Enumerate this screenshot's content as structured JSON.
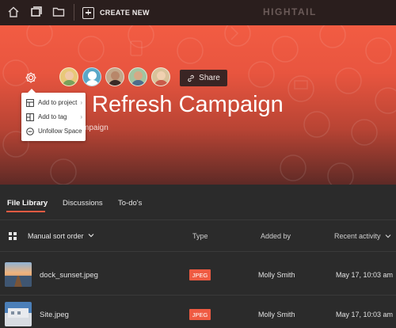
{
  "topbar": {
    "create_new_label": "CREATE NEW",
    "logo_text": "HIGHTAIL"
  },
  "hero": {
    "title": "Refresh Campaign",
    "subtitle": "mpaign",
    "share_label": "Share",
    "accent_color": "#ef5b42"
  },
  "dropdown": {
    "items": [
      {
        "label": "Add to project",
        "icon": "project-icon",
        "has_submenu": true
      },
      {
        "label": "Add to tag",
        "icon": "tag-icon",
        "has_submenu": true
      },
      {
        "label": "Unfollow Space",
        "icon": "unfollow-icon",
        "has_submenu": false
      }
    ]
  },
  "tabs": [
    {
      "label": "File Library",
      "active": true
    },
    {
      "label": "Discussions",
      "active": false
    },
    {
      "label": "To-do's",
      "active": false
    }
  ],
  "list": {
    "sort_label": "Manual sort order",
    "columns": {
      "type": "Type",
      "added_by": "Added by",
      "activity": "Recent activity"
    },
    "rows": [
      {
        "name": "dock_sunset.jpeg",
        "type": "JPEG",
        "added_by": "Molly Smith",
        "activity": "May 17, 10:03 am"
      },
      {
        "name": "Site.jpeg",
        "type": "JPEG",
        "added_by": "Molly Smith",
        "activity": "May 17, 10:03 am"
      }
    ]
  }
}
